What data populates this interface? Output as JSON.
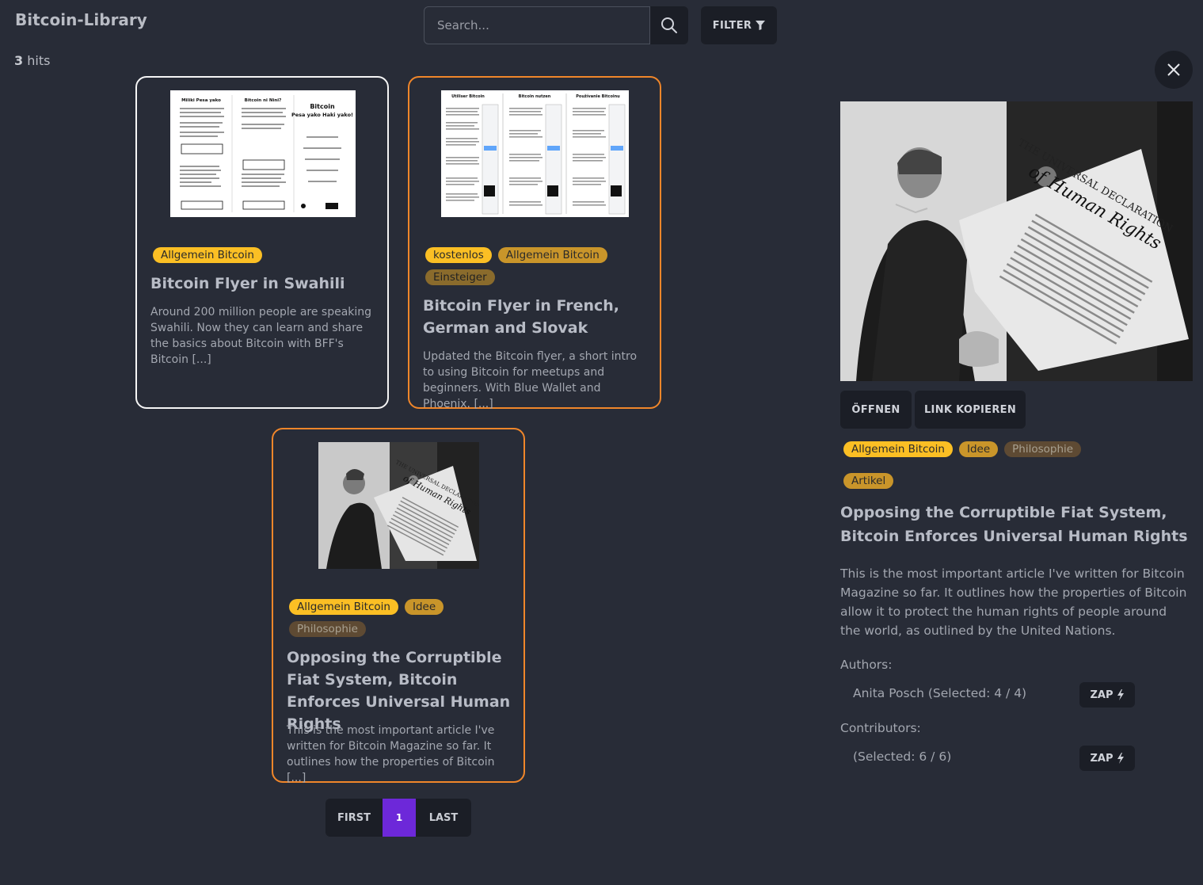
{
  "app": {
    "title": "Bitcoin-Library"
  },
  "results": {
    "count": "3",
    "suffix": " hits"
  },
  "search": {
    "placeholder": "Search...",
    "value": ""
  },
  "toolbar": {
    "filter_label": "FILTER"
  },
  "cards": [
    {
      "tags": [
        "Allgemein Bitcoin"
      ],
      "title": "Bitcoin Flyer in Swahili",
      "description": "Around 200 million people are speaking Swahili. Now they can learn and share the basics about Bitcoin with BFF's Bitcoin [...]",
      "selected": true
    },
    {
      "tags": [
        "kostenlos",
        "Allgemein Bitcoin",
        "Einsteiger"
      ],
      "title": "Bitcoin Flyer in French, German and Slovak",
      "description": "Updated the Bitcoin flyer, a short intro to using Bitcoin for meetups and beginners. With Blue Wallet and Phoenix. [...]",
      "selected": false
    },
    {
      "tags": [
        "Allgemein Bitcoin",
        "Idee",
        "Philosophie"
      ],
      "title": "Opposing the Corruptible Fiat System, Bitcoin Enforces Universal Human Rights",
      "description": "This is the most important article I've written for Bitcoin Magazine so far. It outlines how the properties of Bitcoin [...]",
      "selected": false
    }
  ],
  "pagination": {
    "first": "FIRST",
    "current": "1",
    "last": "LAST"
  },
  "detail": {
    "open_label": "ÖFFNEN",
    "copy_link_label": "LINK KOPIEREN",
    "tags": [
      "Allgemein Bitcoin",
      "Idee",
      "Philosophie",
      "Artikel"
    ],
    "title": "Opposing the Corruptible Fiat System, Bitcoin Enforces Universal Human Rights",
    "description": "This is the most important article I've written for Bitcoin Magazine so far. It outlines how the properties of Bitcoin allow it to protect the human rights of people around the world, as outlined by the United Nations.",
    "authors_label": "Authors:",
    "authors": [
      {
        "name": "Anita Posch (Selected: 4 / 4)",
        "zap_label": "ZAP"
      }
    ],
    "contributors_label": "Contributors:",
    "contributors": [
      {
        "name": "(Selected: 6 / 6)",
        "zap_label": "ZAP"
      }
    ]
  },
  "images": {
    "swahili_flyer_text": [
      "Miliki Pesa yako",
      "Bitcoin ni Nini?",
      "Bitcoin",
      "Pesa yako Haki yako!"
    ],
    "multi_flyer_text": [
      "Utiliser Bitcoin",
      "Bitcoin nutzen",
      "Používanie Bitcoinu"
    ],
    "poster_text": [
      "THE UNIVERSAL DECLARATION",
      "of Human Rights"
    ]
  },
  "colors": {
    "background": "#282c37",
    "button": "#1b1e26",
    "selected_border": "#f5f5f5",
    "card_border": "#f0862a",
    "page_active": "#6d28d9",
    "tag_yellow": "#fbbf24"
  }
}
